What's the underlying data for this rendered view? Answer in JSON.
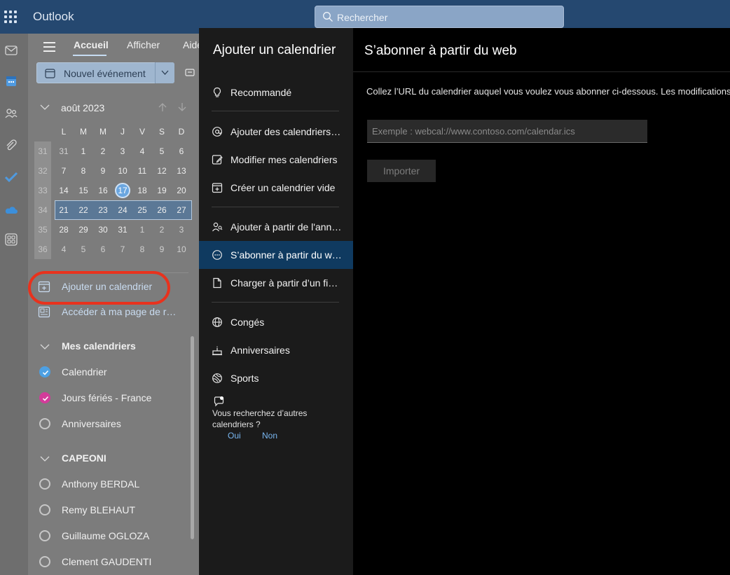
{
  "topbar": {
    "app_title": "Outlook",
    "search_placeholder": "Rechercher"
  },
  "rail": {
    "icons": [
      "mail-icon",
      "calendar-icon",
      "people-icon",
      "attach-icon",
      "todo-icon",
      "onedrive-icon",
      "apps-icon"
    ]
  },
  "ribbon": {
    "tabs": [
      "Accueil",
      "Afficher",
      "Aide"
    ],
    "new_event_label": "Nouvel événement"
  },
  "mini_calendar": {
    "month_label": "août 2023",
    "weekdays": [
      "L",
      "M",
      "M",
      "J",
      "V",
      "S",
      "D"
    ],
    "weeks": [
      {
        "wk": "31",
        "days": [
          "31",
          "1",
          "2",
          "3",
          "4",
          "5",
          "6"
        ]
      },
      {
        "wk": "32",
        "days": [
          "7",
          "8",
          "9",
          "10",
          "11",
          "12",
          "13"
        ]
      },
      {
        "wk": "33",
        "days": [
          "14",
          "15",
          "16",
          "17",
          "18",
          "19",
          "20"
        ]
      },
      {
        "wk": "34",
        "days": [
          "21",
          "22",
          "23",
          "24",
          "25",
          "26",
          "27"
        ]
      },
      {
        "wk": "35",
        "days": [
          "28",
          "29",
          "30",
          "31",
          "1",
          "2",
          "3"
        ]
      },
      {
        "wk": "36",
        "days": [
          "4",
          "5",
          "6",
          "7",
          "8",
          "9",
          "10"
        ]
      }
    ],
    "today": "17",
    "selected_week": "34"
  },
  "nav_actions": {
    "add_calendar": "Ajouter un calendrier",
    "booking_page": "Accéder à ma page de réservation"
  },
  "my_calendars": {
    "heading": "Mes calendriers",
    "items": [
      {
        "label": "Calendrier",
        "checked": true,
        "color": "#4da0e3"
      },
      {
        "label": "Jours fériés - France",
        "checked": true,
        "color": "#d33b9a"
      },
      {
        "label": "Anniversaires",
        "checked": false,
        "color": "#c7c7c7"
      }
    ]
  },
  "group_calendars": {
    "heading": "CAPEONI",
    "items": [
      {
        "label": "Anthony BERDAL"
      },
      {
        "label": "Remy BLEHAUT"
      },
      {
        "label": "Guillaume OGLOZA"
      },
      {
        "label": "Clement GAUDENTI"
      }
    ]
  },
  "dialog": {
    "title": "Ajouter un calendrier",
    "menu": [
      {
        "label": "Recommandé",
        "icon": "lightbulb-icon"
      },
      {
        "label": "Ajouter des calendriers personnels",
        "icon": "at-icon"
      },
      {
        "label": "Modifier mes calendriers",
        "icon": "edit-icon"
      },
      {
        "label": "Créer un calendrier vide",
        "icon": "calendar-add-icon"
      },
      {
        "label": "Ajouter à partir de l'annuaire",
        "icon": "people-search-icon"
      },
      {
        "label": "S’abonner à partir du web",
        "icon": "subscribe-icon",
        "active": true
      },
      {
        "label": "Charger à partir d’un fichier",
        "icon": "file-icon"
      },
      {
        "label": "Congés",
        "icon": "globe-icon"
      },
      {
        "label": "Anniversaires",
        "icon": "cake-icon"
      },
      {
        "label": "Sports",
        "icon": "sports-icon"
      }
    ],
    "feedback_text": "Vous recherchez d’autres calendriers ?",
    "feedback_yes": "Oui",
    "feedback_no": "Non"
  },
  "subscribe": {
    "title": "S’abonner à partir du web",
    "description": "Collez l’URL du calendrier auquel vous voulez vous abonner ci-dessous. Les modifications",
    "url_placeholder": "Exemple : webcal://www.contoso.com/calendar.ics",
    "url_value": "",
    "import_button": "Importer"
  },
  "colors": {
    "accent": "#6aa6e0",
    "highlight_ring": "#e8321d",
    "active_menu": "#0f3a60"
  }
}
